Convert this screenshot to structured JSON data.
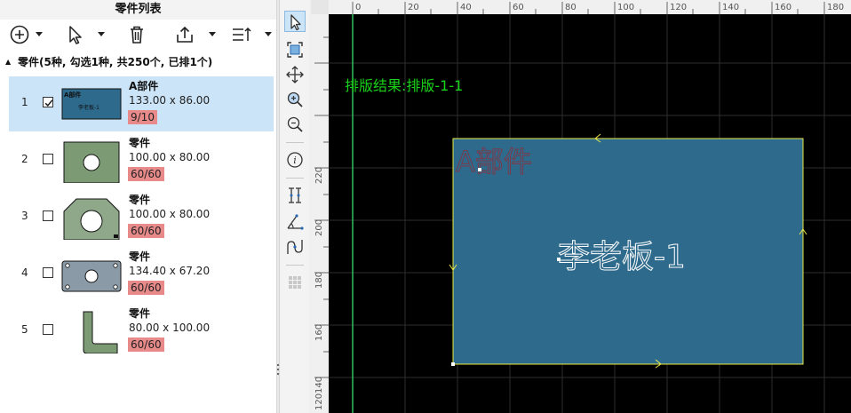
{
  "panel": {
    "title": "零件列表",
    "group_label": "零件(5种, 勾选1种, 共250个, 已排1个)"
  },
  "toolbar": {
    "icons": [
      "add-icon",
      "pointer-icon",
      "delete-icon",
      "export-icon",
      "sort-icon"
    ]
  },
  "parts": [
    {
      "index": "1",
      "name": "A部件",
      "size": "133.00 x 86.00",
      "count": "9/10",
      "checked": true,
      "selected": true,
      "thumb_labels": {
        "name": "A部件",
        "tag": "李老板-1"
      }
    },
    {
      "index": "2",
      "name": "零件",
      "size": "100.00 x 80.00",
      "count": "60/60",
      "checked": false,
      "selected": false
    },
    {
      "index": "3",
      "name": "零件",
      "size": "100.00 x 80.00",
      "count": "60/60",
      "checked": false,
      "selected": false
    },
    {
      "index": "4",
      "name": "零件",
      "size": "134.40 x 67.20",
      "count": "60/60",
      "checked": false,
      "selected": false
    },
    {
      "index": "5",
      "name": "零件",
      "size": "80.00 x 100.00",
      "count": "60/60",
      "checked": false,
      "selected": false
    }
  ],
  "canvas": {
    "result_label": "排版结果:排版-1-1",
    "part_name": "A部件",
    "part_tag": "李老板-1",
    "ruler_top": [
      "0",
      "20",
      "40",
      "60",
      "80",
      "100",
      "120",
      "140",
      "160",
      "180"
    ],
    "ruler_left": [
      "220",
      "200",
      "180",
      "160",
      "140",
      "120"
    ],
    "colors": {
      "part_fill": "#2e6a8c",
      "part_outline": "#e8e84a",
      "guide": "#33cc66",
      "label": "#19d219"
    }
  }
}
